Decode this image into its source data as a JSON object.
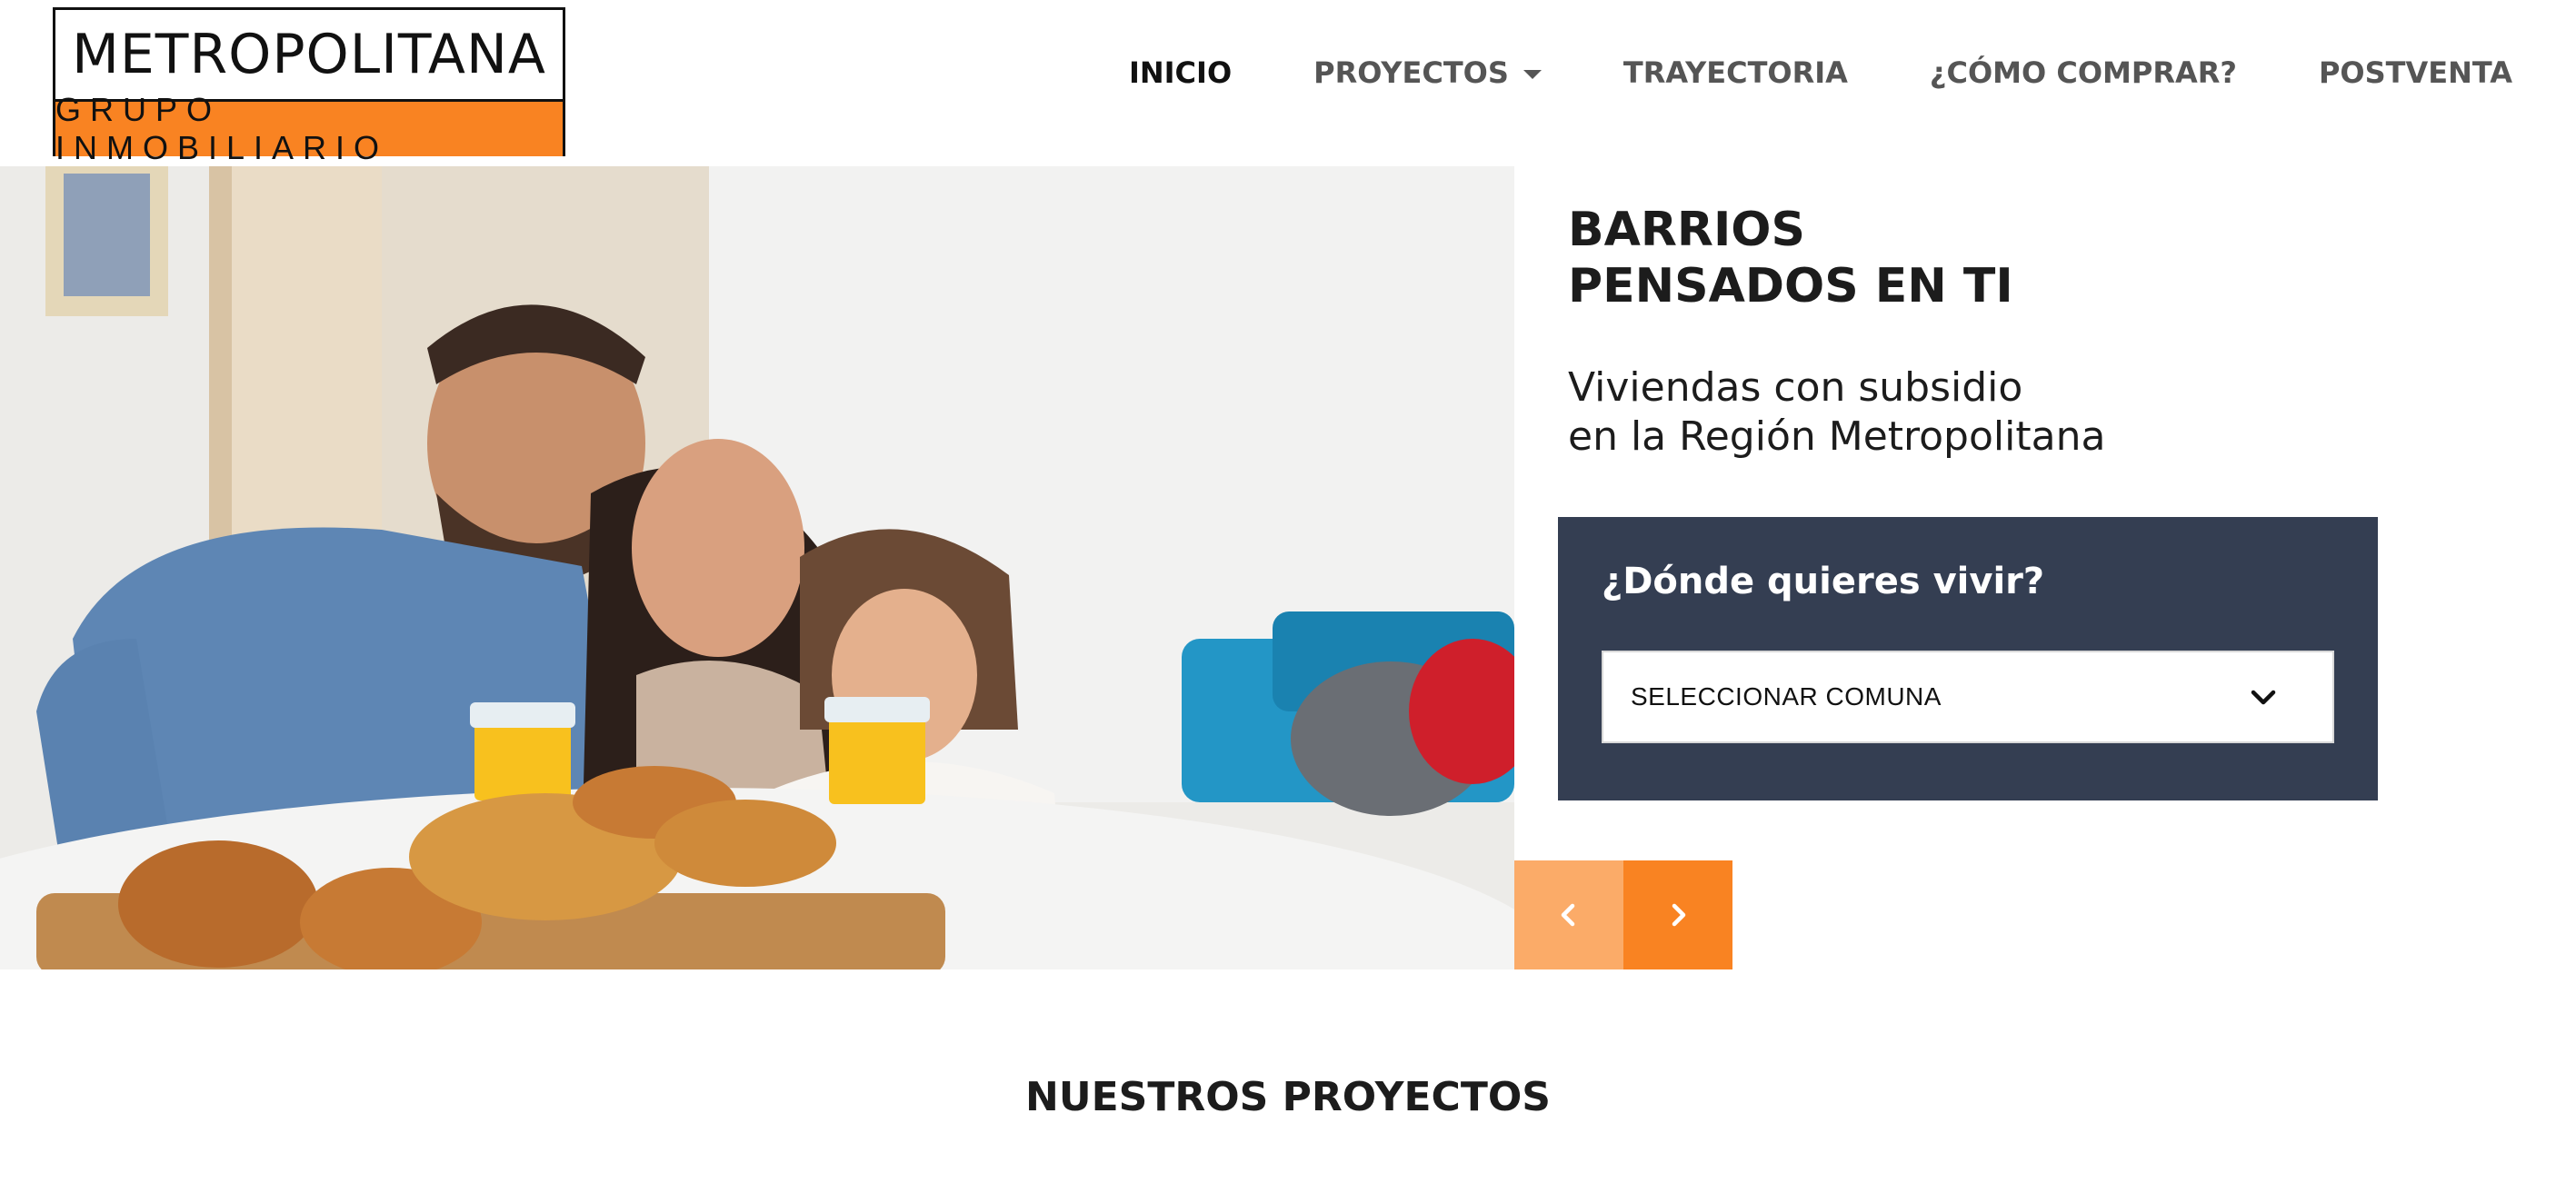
{
  "brand": {
    "logo_top": "METROPOLITANA",
    "logo_bottom": "GRUPO INMOBILIARIO",
    "accent_color": "#f98322",
    "dark_panel_color": "#343e52"
  },
  "nav": {
    "items": [
      {
        "label": "INICIO",
        "active": true
      },
      {
        "label": "PROYECTOS",
        "has_dropdown": true
      },
      {
        "label": "TRAYECTORIA"
      },
      {
        "label": "¿CÓMO COMPRAR?"
      },
      {
        "label": "POSTVENTA"
      }
    ]
  },
  "hero": {
    "title_line1": "BARRIOS",
    "title_line2": "PENSADOS EN TI",
    "subtitle_line1": "Viviendas con subsidio",
    "subtitle_line2": "en la Región Metropolitana",
    "photo_icon": "family-breakfast-photo",
    "search": {
      "title": "¿Dónde quieres vivir?",
      "select_value": "SELECCIONAR COMUNA",
      "select_icon": "chevron-down-icon"
    },
    "slider": {
      "prev_icon": "chevron-left-icon",
      "next_icon": "chevron-right-icon"
    }
  },
  "sections": {
    "projects_title": "NUESTROS PROYECTOS"
  }
}
